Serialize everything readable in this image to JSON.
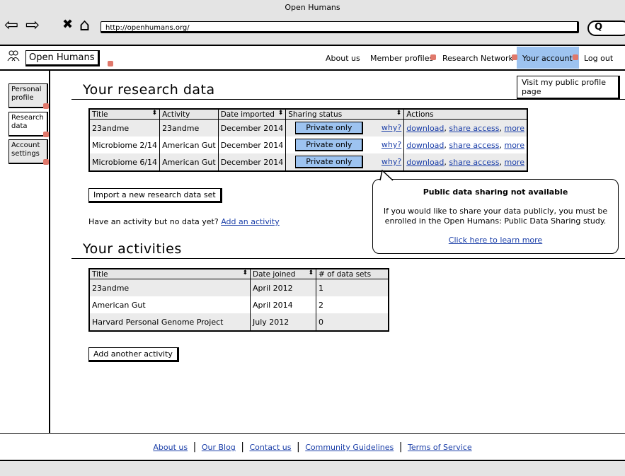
{
  "browser": {
    "window_title": "Open Humans",
    "url": "http://openhumans.org/",
    "back_glyph": "⇦",
    "forward_glyph": "⇨",
    "stop_glyph": "✖",
    "home_glyph": "⌂",
    "search_glyph": "Q"
  },
  "header": {
    "logo_text": "Open Humans",
    "nav": [
      "About us",
      "Member profiles",
      "Research Network",
      "Your account",
      "Log out"
    ]
  },
  "sidebar": {
    "items": [
      {
        "label": "Personal profile"
      },
      {
        "label": "Research data"
      },
      {
        "label": "Account settings"
      }
    ]
  },
  "profile_button": "Visit my public profile page",
  "research": {
    "heading": "Your research data",
    "columns": [
      "Title",
      "Activity",
      "Date imported",
      "Sharing status",
      "Actions"
    ],
    "rows": [
      {
        "title": "23andme",
        "activity": "23andme",
        "date": "December 2014",
        "status": "Private only",
        "why": "why?"
      },
      {
        "title": "Microbiome 2/14",
        "activity": "American Gut",
        "date": "December 2014",
        "status": "Private only",
        "why": "why?"
      },
      {
        "title": "Microbiome 6/14",
        "activity": "American Gut",
        "date": "December 2014",
        "status": "Private only",
        "why": "why?"
      }
    ],
    "action_download": "download",
    "action_share": "share access",
    "action_more": "more",
    "import_button": "Import a new research data set",
    "no_data_text": "Have an activity but no data yet?",
    "add_activity_link": "Add an activity"
  },
  "popover": {
    "title": "Public data sharing not available",
    "line1": "If you would like to share your data publicly, you must be",
    "line2": "enrolled in the Open Humans: Public Data Sharing study.",
    "link": "Click here to learn more"
  },
  "activities": {
    "heading": "Your activities",
    "columns": [
      "Title",
      "Date joined",
      "# of data sets"
    ],
    "rows": [
      {
        "title": "23andme",
        "date": "April 2012",
        "count": "1"
      },
      {
        "title": "American Gut",
        "date": "April 2014",
        "count": "2"
      },
      {
        "title": "Harvard Personal Genome Project",
        "date": "July 2012",
        "count": "0"
      }
    ],
    "add_button": "Add another activity"
  },
  "footer": {
    "links": [
      "About us",
      "Our Blog",
      "Contact us",
      "Community Guidelines",
      "Terms of Service"
    ]
  },
  "colors": {
    "accent": "#9dc3f0",
    "link": "#1a3ea8",
    "flag": "#e0786b"
  }
}
